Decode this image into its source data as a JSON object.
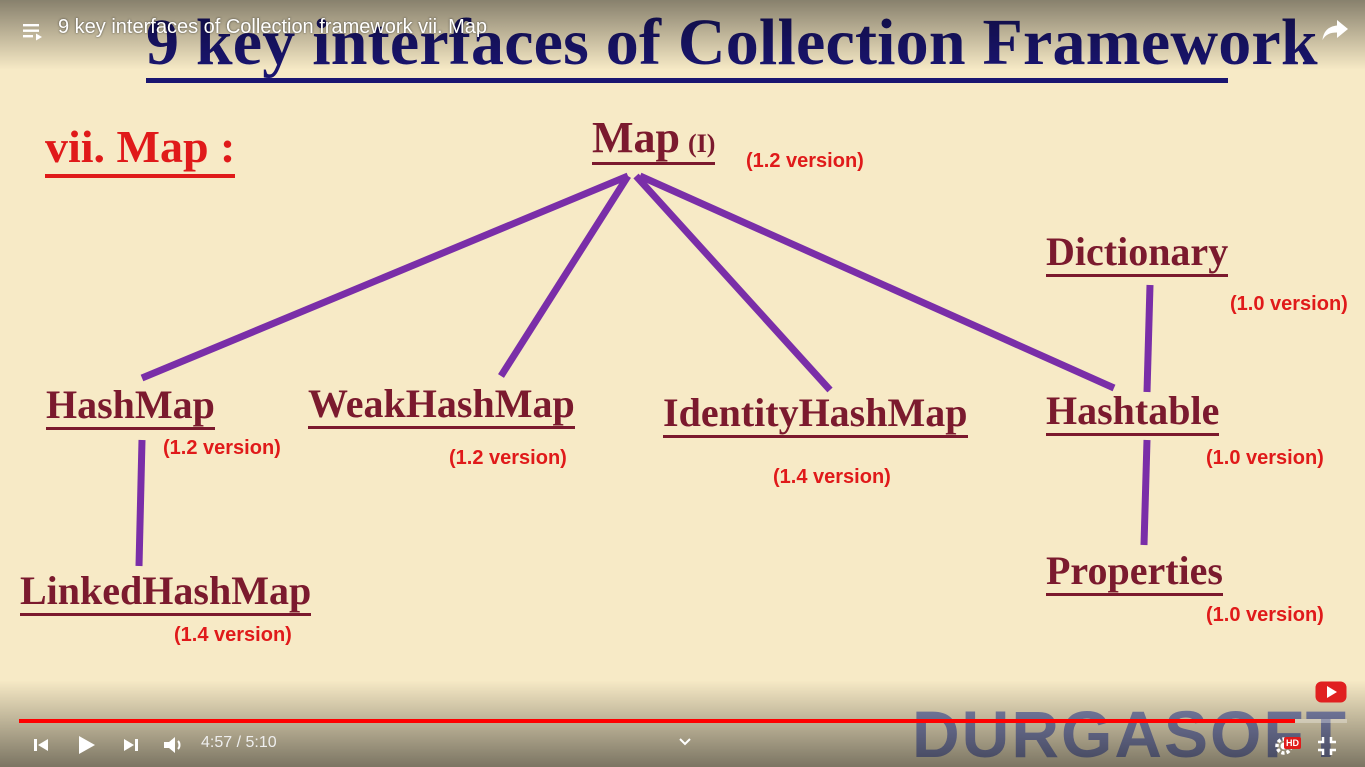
{
  "player": {
    "video_title": "9 key interfaces of Collection framework vii. Map",
    "current_time": "4:57",
    "duration": "5:10",
    "time_display": "4:57 / 5:10",
    "progress_fraction": 0.961,
    "hd_badge": "HD",
    "icons": {
      "playlist": "playlist-icon",
      "share": "share-icon",
      "previous": "previous-icon",
      "play": "play-icon",
      "next": "next-icon",
      "volume": "volume-icon",
      "chevron": "chevron-down-icon",
      "settings": "settings-icon",
      "exit_fullscreen": "exit-fullscreen-icon",
      "subscribe": "youtube-subscribe-icon"
    },
    "colors": {
      "progress": "#ff0000",
      "hd": "#e01a1a"
    }
  },
  "slide": {
    "title": "9 key interfaces of Collection Framework",
    "section": "vii. Map :",
    "watermark": "DURGASOFT",
    "root": {
      "name": "Map",
      "suffix": "(I)",
      "version": "(1.2 version)"
    },
    "nodes": {
      "hashmap": {
        "name": "HashMap",
        "version": "(1.2 version)"
      },
      "weakhashmap": {
        "name": "WeakHashMap",
        "version": "(1.2 version)"
      },
      "identityhashmap": {
        "name": "IdentityHashMap",
        "version": "(1.4 version)"
      },
      "hashtable": {
        "name": "Hashtable",
        "version": "(1.0 version)"
      },
      "dictionary": {
        "name": "Dictionary",
        "version": "(1.0 version)"
      },
      "linkedhashmap": {
        "name": "LinkedHashMap",
        "version": "(1.4 version)"
      },
      "properties": {
        "name": "Properties",
        "version": "(1.0 version)"
      }
    },
    "colors": {
      "title": "#1a1570",
      "section": "#e01a1a",
      "node": "#7b1a2e",
      "version": "#e01a1a",
      "connector": "#7a2ea8",
      "background": "#f7eac6"
    }
  }
}
